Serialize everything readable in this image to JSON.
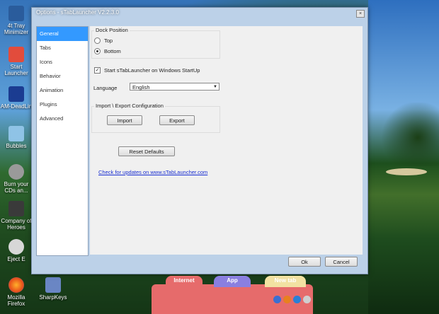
{
  "window": {
    "title": "Options - sTabLauncher V2.2.3.0",
    "close_label": "×"
  },
  "sidebar": {
    "items": [
      {
        "label": "General",
        "active": true
      },
      {
        "label": "Tabs"
      },
      {
        "label": "Icons"
      },
      {
        "label": "Behavior"
      },
      {
        "label": "Animation"
      },
      {
        "label": "Plugins"
      },
      {
        "label": "Advanced"
      }
    ]
  },
  "general": {
    "dock_position_label": "Dock Position",
    "top_label": "Top",
    "bottom_label": "Bottom",
    "selected_position": "Bottom",
    "startup_label": "Start sTabLauncher on Windows StartUp",
    "startup_checked": true,
    "language_label": "Language",
    "language_value": "English",
    "import_export_label": "Import \\ Export Configuration",
    "import_label": "Import",
    "export_label": "Export",
    "reset_label": "Reset Defaults",
    "update_link": "Check for updates on www.sTabLauncher.com"
  },
  "footer": {
    "ok_label": "Ok",
    "cancel_label": "Cancel"
  },
  "desktop_icons": [
    {
      "label": "4t Tray Minimizer",
      "icon": "tray-minimizer-icon"
    },
    {
      "label": "Start Launcher",
      "icon": "start-launcher-icon"
    },
    {
      "label": "AM-DeadLin",
      "icon": "deadline-icon"
    },
    {
      "label": "Bubbles",
      "icon": "bubbles-icon"
    },
    {
      "label": "Burn your CDs an...",
      "icon": "burn-cd-icon"
    },
    {
      "label": "Company of Heroes",
      "icon": "company-of-heroes-icon"
    },
    {
      "label": "Eject E",
      "icon": "eject-icon"
    },
    {
      "label": "Mozilla Firefox",
      "icon": "firefox-icon"
    },
    {
      "label": "SharpKeys",
      "icon": "sharpkeys-icon"
    }
  ],
  "dock": {
    "tabs": [
      {
        "label": "Internet",
        "color": "#e66b6b"
      },
      {
        "label": "App",
        "color": "#8a7fe0"
      },
      {
        "label": "New tab",
        "color": "#f2e2a2"
      }
    ]
  }
}
